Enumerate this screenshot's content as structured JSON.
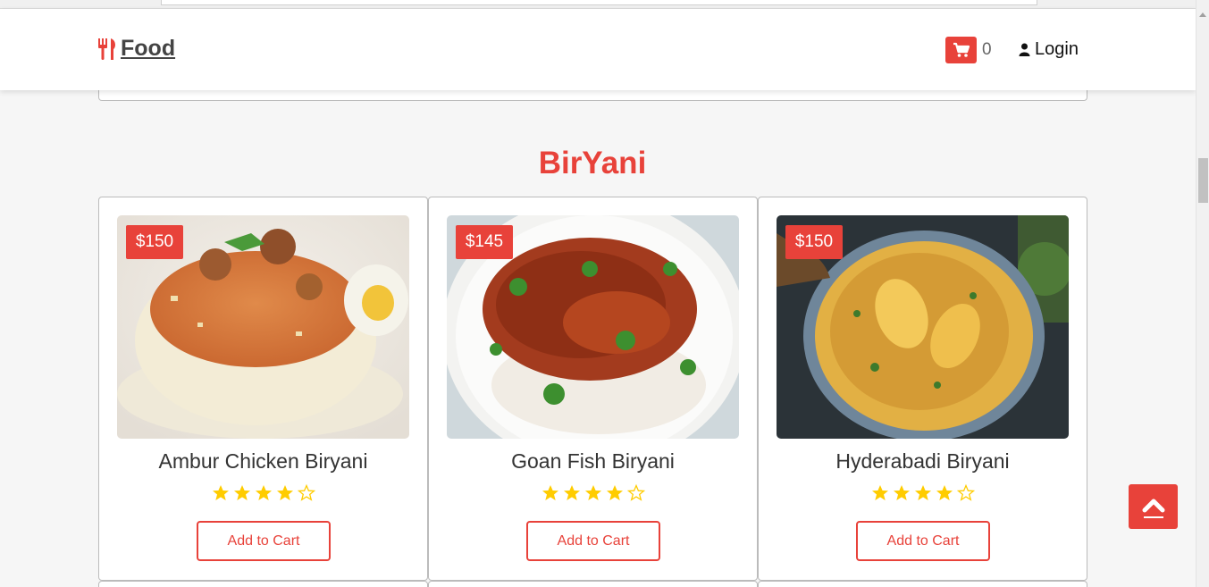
{
  "brand": {
    "name": "Food",
    "icon": "cutlery-icon"
  },
  "nav": {
    "cart_count": "0",
    "cart_icon": "shopping-cart-icon",
    "login_label": "Login",
    "login_icon": "user-icon"
  },
  "section": {
    "title": "BirYani"
  },
  "colors": {
    "accent": "#e8423a",
    "star": "#ffcc00",
    "card_border": "#bbbbbb"
  },
  "products": [
    {
      "name": "Ambur Chicken Biryani",
      "price": "$150",
      "rating": 4,
      "max_rating": 5,
      "button_label": "Add to Cart"
    },
    {
      "name": "Goan Fish Biryani",
      "price": "$145",
      "rating": 4,
      "max_rating": 5,
      "button_label": "Add to Cart"
    },
    {
      "name": "Hyderabadi Biryani",
      "price": "$150",
      "rating": 4,
      "max_rating": 5,
      "button_label": "Add to Cart"
    }
  ],
  "scroll_top_icon": "chevron-up-icon"
}
